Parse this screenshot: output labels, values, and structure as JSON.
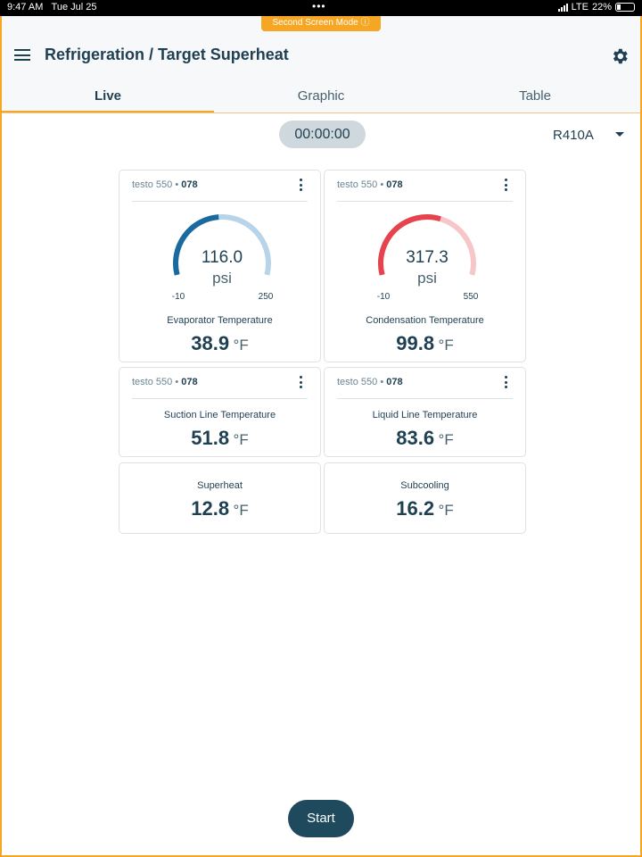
{
  "status": {
    "time": "9:47 AM",
    "date": "Tue Jul 25",
    "network": "LTE",
    "battery": "22%"
  },
  "second_screen_badge": "Second Screen Mode ⓘ",
  "header": {
    "title": "Refrigeration / Target Superheat",
    "menu_icon": "menu-icon",
    "settings_icon": "gear-icon"
  },
  "tabs": [
    {
      "label": "Live",
      "active": true
    },
    {
      "label": "Graphic",
      "active": false
    },
    {
      "label": "Table",
      "active": false
    }
  ],
  "timer": "00:00:00",
  "refrigerant": "R410A",
  "cards": {
    "evap": {
      "device": "testo 550",
      "sep": " • ",
      "id": "078",
      "gauge": {
        "value": "116.0",
        "unit": "psi",
        "min": "-10",
        "max": "250",
        "fraction": 0.48,
        "color": "#1a6aa0",
        "track": "#b8d4e8"
      },
      "label": "Evaporator Temperature",
      "reading": "38.9",
      "unit": "°F"
    },
    "cond": {
      "device": "testo 550",
      "sep": " • ",
      "id": "078",
      "gauge": {
        "value": "317.3",
        "unit": "psi",
        "min": "-10",
        "max": "550",
        "fraction": 0.58,
        "color": "#e5434e",
        "track": "#f6c6c9"
      },
      "label": "Condensation Temperature",
      "reading": "99.8",
      "unit": "°F"
    },
    "suction": {
      "device": "testo 550",
      "sep": " • ",
      "id": "078",
      "label": "Suction Line Temperature",
      "reading": "51.8",
      "unit": "°F"
    },
    "liquid": {
      "device": "testo 550",
      "sep": " • ",
      "id": "078",
      "label": "Liquid Line Temperature",
      "reading": "83.6",
      "unit": "°F"
    },
    "superheat": {
      "label": "Superheat",
      "reading": "12.8",
      "unit": "°F"
    },
    "subcooling": {
      "label": "Subcooling",
      "reading": "16.2",
      "unit": "°F"
    }
  },
  "start_button": "Start"
}
